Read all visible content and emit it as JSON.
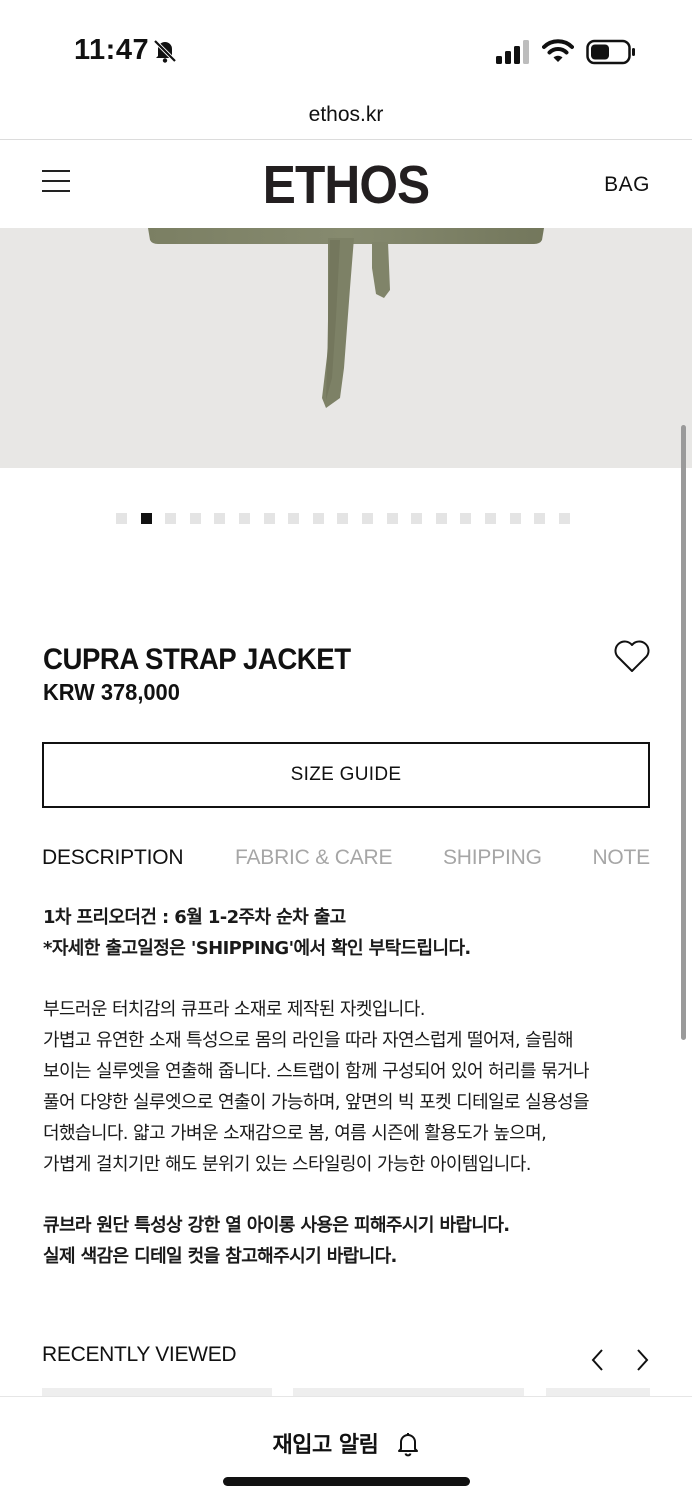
{
  "status_bar": {
    "time": "11:47",
    "icons": [
      "bell-slash-icon",
      "cellular-signal-icon",
      "wifi-icon",
      "battery-icon"
    ]
  },
  "browser": {
    "url": "ethos.kr"
  },
  "header": {
    "logo": "ETHOS",
    "bag_label": "BAG",
    "menu_icon": "hamburger-menu-icon"
  },
  "gallery": {
    "total_slides": 19,
    "active_index": 1
  },
  "product": {
    "name": "CUPRA STRAP JACKET",
    "price": "KRW 378,000",
    "size_guide_label": "SIZE GUIDE"
  },
  "tabs": [
    "DESCRIPTION",
    "FABRIC & CARE",
    "SHIPPING",
    "NOTE"
  ],
  "active_tab": "DESCRIPTION",
  "description": {
    "notice_line1": "1차 프리오더건 : 6월 1-2주차 순차 출고",
    "notice_line2": "*자세한 출고일정은 'SHIPPING'에서 확인 부탁드립니다.",
    "body_lines": [
      "부드러운 터치감의 큐프라 소재로 제작된 자켓입니다.",
      "가볍고 유연한 소재 특성으로 몸의 라인을 따라 자연스럽게 떨어져, 슬림해",
      "보이는 실루엣을 연출해 줍니다. 스트랩이 함께 구성되어 있어 허리를 묶거나",
      "풀어 다양한 실루엣으로 연출이 가능하며, 앞면의 빅 포켓 디테일로 실용성을",
      "더했습니다. 얇고 가벼운 소재감으로 봄, 여름 시즌에 활용도가 높으며,",
      "가볍게 걸치기만 해도 분위기 있는 스타일링이 가능한 아이템입니다."
    ],
    "warning_line1": "큐브라 원단 특성상 강한 열 아이롱 사용은 피해주시기 바랍니다.",
    "warning_line2": "실제 색감은 디테일 컷을 참고해주시기 바랍니다."
  },
  "recently_viewed": {
    "title": "RECENTLY VIEWED"
  },
  "bottom_bar": {
    "restock_label": "재입고 알림"
  },
  "colors": {
    "text": "#111111",
    "muted_tab": "#a6a6a6",
    "image_bg": "#e8e7e5",
    "fabric": "#7e8267"
  }
}
